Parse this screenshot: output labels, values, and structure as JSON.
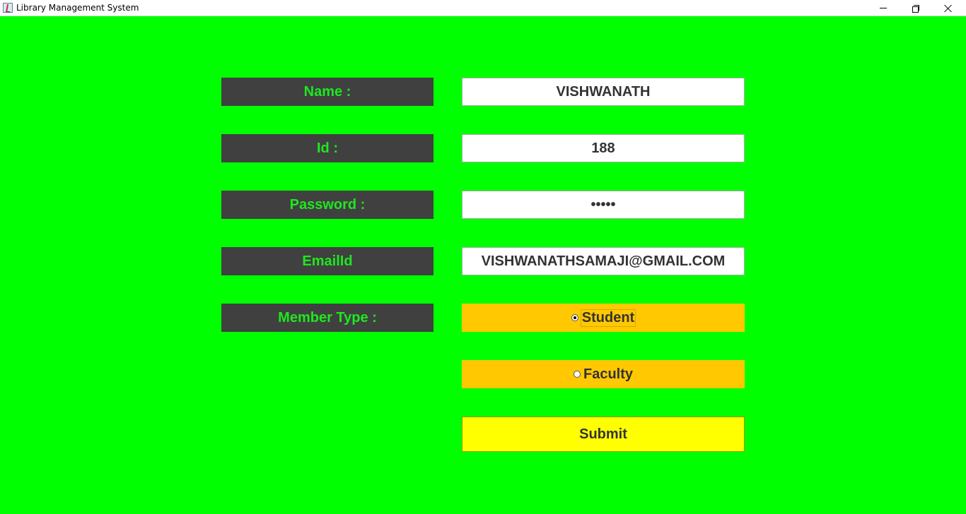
{
  "window": {
    "title": "Library Management System",
    "controls": {
      "minimize_icon": "minimize-icon",
      "maximize_icon": "restore-icon",
      "close_icon": "close-icon"
    }
  },
  "form": {
    "name_label": "Name :",
    "name_value": "VISHWANATH",
    "id_label": "Id :",
    "id_value": "188",
    "password_label": "Password :",
    "password_value": "•••••",
    "email_label": "EmailId",
    "email_value": "VISHWANATHSAMAJI@GMAIL.COM",
    "member_type_label": "Member Type :",
    "member_types": [
      {
        "label": "Student",
        "selected": true
      },
      {
        "label": "Faculty",
        "selected": false
      }
    ],
    "submit_label": "Submit"
  },
  "colors": {
    "background": "#00ff00",
    "label_bg": "#404040",
    "label_text": "#1ee81e",
    "radio_bg": "#ffc800",
    "submit_bg": "#ffff00"
  }
}
